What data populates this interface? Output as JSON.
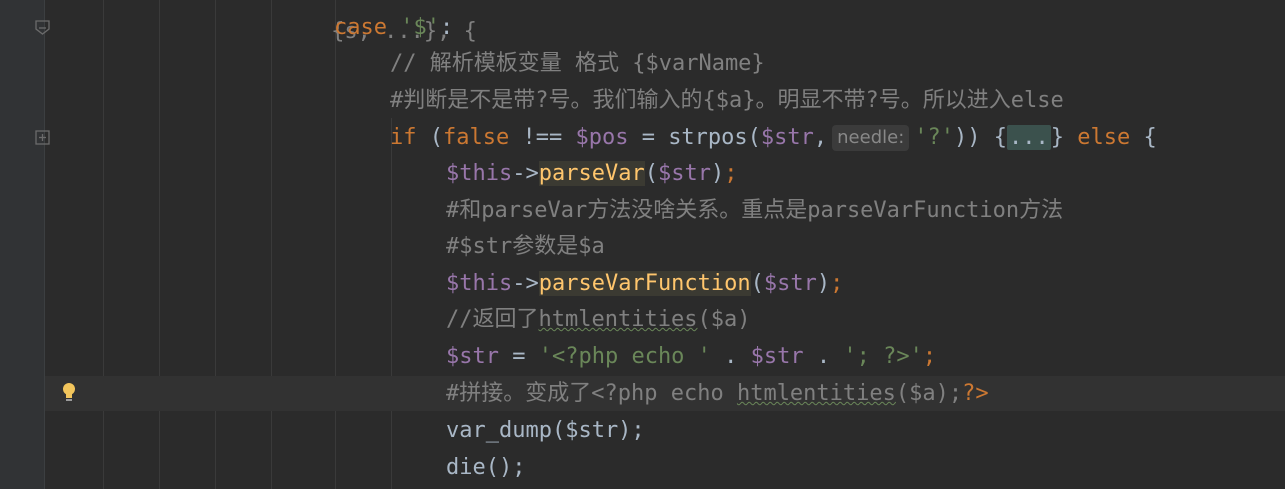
{
  "editor": {
    "top_fragment": "                     {s, ...}, {",
    "lines": {
      "l1": {
        "kw": "case",
        "str": "'$'",
        "punc": ":"
      },
      "l2": {
        "text": "// 解析模板变量 格式 {$varName}"
      },
      "l3": {
        "text": "#判断是不是带?号。我们输入的{$a}。明显不带?号。所以进入else"
      },
      "l4": {
        "kw_if": "if",
        "p1": " (",
        "kw_false": "false",
        "p2": " !== ",
        "var_pos": "$pos",
        "p3": " = strpos(",
        "var_str": "$str",
        "p4": ",",
        "hint": "needle:",
        "str_q": "'?'",
        "p5": ")) {",
        "fold": "...",
        "p6": "}",
        "kw_else": "else",
        "p7": " {"
      },
      "l5": {
        "var_this": "$this",
        "arrow": "->",
        "fn": "parseVar",
        "open": "(",
        "var_str": "$str",
        "close": ")",
        "semi": ";"
      },
      "l6": {
        "text": "#和parseVar方法没啥关系。重点是parseVarFunction方法"
      },
      "l7": {
        "text": "#$str参数是$a"
      },
      "l8": {
        "var_this": "$this",
        "arrow": "->",
        "fn": "parseVarFunction",
        "open": "(",
        "var_str": "$str",
        "close": ")",
        "semi": ";"
      },
      "l9": {
        "pre": "//返回了",
        "warn": "htmlentities",
        "post": "($a)"
      },
      "l10": {
        "var_str": "$str",
        "eq": " = ",
        "s1": "'<?php echo '",
        "dot1": " . ",
        "var_str2": "$str",
        "dot2": " . ",
        "s2": "'; ?>'",
        "semi": ";"
      },
      "l11": {
        "pre": "#拼接。变成了<?php echo ",
        "warn": "htmlentities",
        "post": "($a);",
        "tag": "?>"
      },
      "l12": {
        "text": "var_dump($str);"
      },
      "l13": {
        "text": "die();"
      }
    }
  },
  "colors": {
    "background": "#2b2b2b",
    "keyword": "#cc7832",
    "string": "#6a8759",
    "comment": "#808080",
    "variable": "#9876aa",
    "function_highlight": "#ffc66d"
  },
  "icons": {
    "gutter_fold_1": "fold-end-icon",
    "gutter_fold_2": "fold-expand-icon",
    "intention": "lightbulb-icon"
  }
}
